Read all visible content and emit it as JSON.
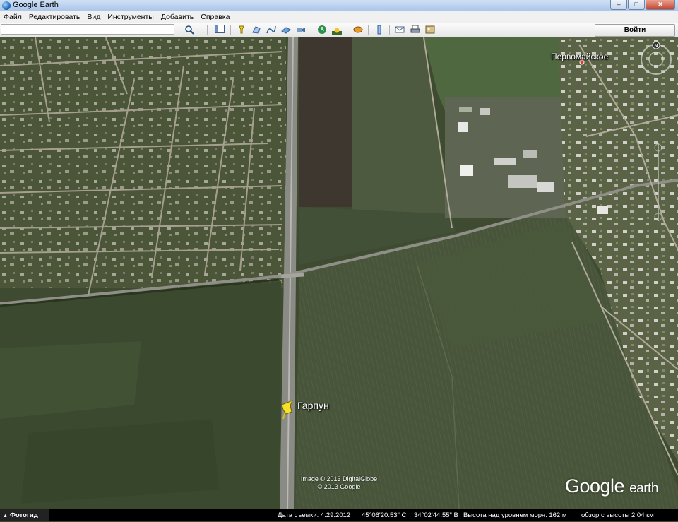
{
  "window": {
    "title": "Google Earth",
    "controls": [
      "–",
      "□",
      "✕"
    ]
  },
  "menu": [
    "Файл",
    "Редактировать",
    "Вид",
    "Инструменты",
    "Добавить",
    "Справка"
  ],
  "toolbar": {
    "search_value": "",
    "signin_label": "Войти",
    "icons": [
      "search-icon",
      "sidebar-toggle-icon",
      "placemark-icon",
      "polygon-icon",
      "path-icon",
      "image-overlay-icon",
      "record-tour-icon",
      "historical-imagery-icon",
      "sunlight-icon",
      "planets-icon",
      "ruler-icon",
      "email-icon",
      "print-icon",
      "save-image-icon"
    ]
  },
  "map": {
    "place_label": "Первомайское",
    "pin_label": "Гарпун",
    "attribution": [
      "Image © 2013 DigitalGlobe",
      "© 2013 Google"
    ],
    "brand_google": "Google",
    "brand_earth": "earth",
    "compass_north": "N"
  },
  "status": {
    "tour_label": "Фотогид",
    "date": "Дата съемки: 4.29.2012",
    "lat": "45°06'20.53\" С",
    "lon": "34°02'44.55\" В",
    "elevation": "Высота над уровнем моря:  162 м",
    "eye_alt": "обзор с высоты  2.04 км"
  }
}
